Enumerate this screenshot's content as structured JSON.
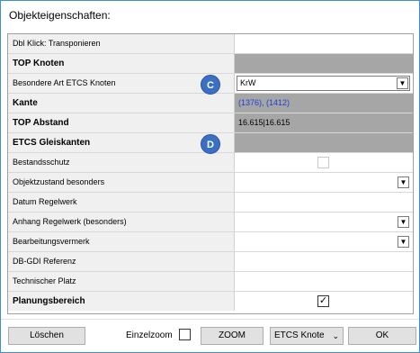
{
  "window": {
    "title": "Objekteigenschaften:"
  },
  "rows": [
    {
      "label": "Dbl Klick: Transponieren",
      "bold": false,
      "value": ""
    },
    {
      "label": "TOP Knoten",
      "bold": true,
      "value": ""
    },
    {
      "label": "Besondere Art ETCS Knoten",
      "bold": false,
      "value": "KrW"
    },
    {
      "label": "Kante",
      "bold": true,
      "value": "(1376), (1412)"
    },
    {
      "label": "TOP Abstand",
      "bold": true,
      "value": "16.615|16.615"
    },
    {
      "label": "ETCS Gleiskanten",
      "bold": true,
      "value": ""
    },
    {
      "label": "Bestandsschutz",
      "bold": false,
      "value": ""
    },
    {
      "label": "Objektzustand besonders",
      "bold": false,
      "value": ""
    },
    {
      "label": "Datum Regelwerk",
      "bold": false,
      "value": ""
    },
    {
      "label": "Anhang Regelwerk (besonders)",
      "bold": false,
      "value": ""
    },
    {
      "label": "Bearbeitungsvermerk",
      "bold": false,
      "value": ""
    },
    {
      "label": "DB-GDI Referenz",
      "bold": false,
      "value": ""
    },
    {
      "label": "Technischer Platz",
      "bold": false,
      "value": ""
    },
    {
      "label": "Planungsbereich",
      "bold": true,
      "value": ""
    }
  ],
  "badges": {
    "c": "C",
    "d": "D"
  },
  "checks": {
    "bestandsschutz": "",
    "planungsbereich": "✓"
  },
  "icons": {
    "dropdown": "▼",
    "chevron": "⌄"
  },
  "footer": {
    "delete_label": "Löschen",
    "einzelzoom_label": "Einzelzoom",
    "zoom_label": "ZOOM",
    "mode_select_value": "ETCS Knote",
    "ok_label": "OK"
  },
  "colors": {
    "window_border": "#3a8fd8",
    "gray_cell": "#a6a6a6",
    "label_bg": "#f0f0f0",
    "badge": "#3b6fc4",
    "link_text": "#1a3fd6"
  }
}
